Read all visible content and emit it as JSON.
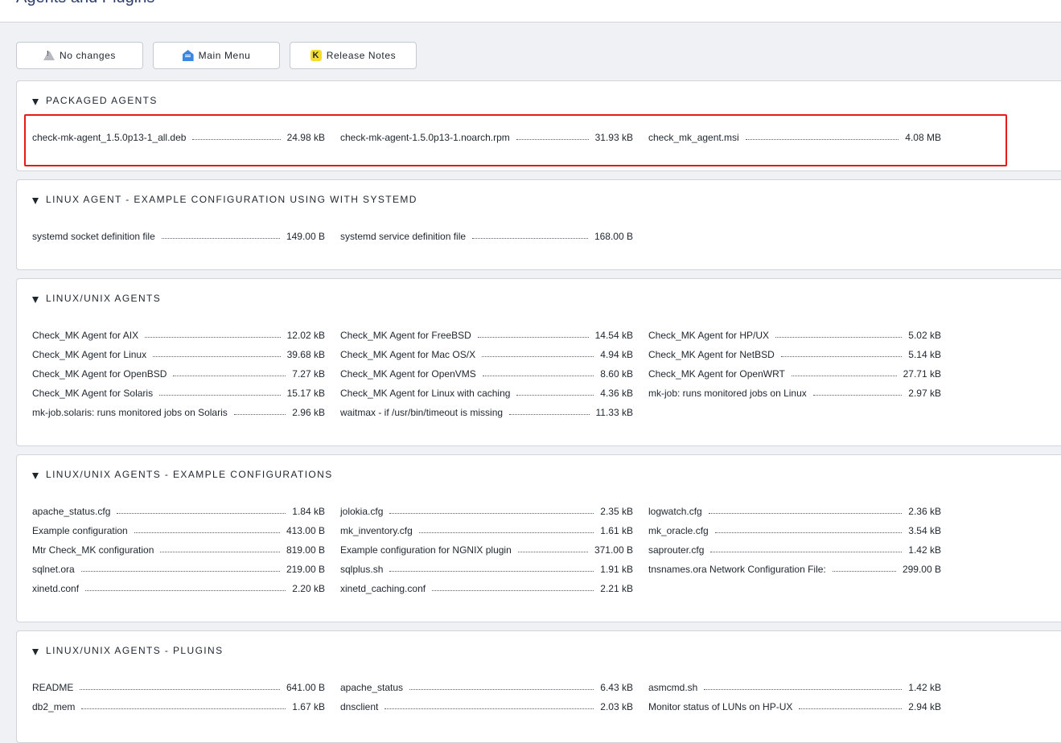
{
  "page": {
    "title": "Agents and Plugins"
  },
  "toolbar": {
    "no_changes_label": "No changes",
    "main_menu_label": "Main Menu",
    "release_notes_label": "Release Notes",
    "release_notes_icon_letter": "K"
  },
  "colors": {
    "highlight_border": "#e41b1b",
    "home_icon": "#3a86e0",
    "release_notes_icon": "#f5dc2e",
    "title_text": "#2d3e6d"
  },
  "sections": [
    {
      "title": "PACKAGED AGENTS",
      "highlighted": true,
      "items": [
        {
          "name": "check-mk-agent_1.5.0p13-1_all.deb",
          "size": "24.98 kB"
        },
        {
          "name": "check-mk-agent-1.5.0p13-1.noarch.rpm",
          "size": "31.93 kB"
        },
        {
          "name": "check_mk_agent.msi",
          "size": "4.08 MB"
        }
      ]
    },
    {
      "title": "LINUX AGENT - EXAMPLE CONFIGURATION USING WITH SYSTEMD",
      "items": [
        {
          "name": "systemd socket definition file",
          "size": "149.00 B"
        },
        {
          "name": "systemd service definition file",
          "size": "168.00 B"
        }
      ]
    },
    {
      "title": "LINUX/UNIX AGENTS",
      "items": [
        {
          "name": "Check_MK Agent for AIX",
          "size": "12.02 kB"
        },
        {
          "name": "Check_MK Agent for FreeBSD",
          "size": "14.54 kB"
        },
        {
          "name": "Check_MK Agent for HP/UX",
          "size": "5.02 kB"
        },
        {
          "name": "Check_MK Agent for Linux",
          "size": "39.68 kB"
        },
        {
          "name": "Check_MK Agent for Mac OS/X",
          "size": "4.94 kB"
        },
        {
          "name": "Check_MK Agent for NetBSD",
          "size": "5.14 kB"
        },
        {
          "name": "Check_MK Agent for OpenBSD",
          "size": "7.27 kB"
        },
        {
          "name": "Check_MK Agent for OpenVMS",
          "size": "8.60 kB"
        },
        {
          "name": "Check_MK Agent for OpenWRT",
          "size": "27.71 kB"
        },
        {
          "name": "Check_MK Agent for Solaris",
          "size": "15.17 kB"
        },
        {
          "name": "Check_MK Agent for Linux with caching",
          "size": "4.36 kB"
        },
        {
          "name": "mk-job: runs monitored jobs on Linux",
          "size": "2.97 kB"
        },
        {
          "name": "mk-job.solaris: runs monitored jobs on Solaris",
          "size": "2.96 kB"
        },
        {
          "name": "waitmax - if /usr/bin/timeout is missing",
          "size": "11.33 kB"
        }
      ]
    },
    {
      "title": "LINUX/UNIX AGENTS - EXAMPLE CONFIGURATIONS",
      "items": [
        {
          "name": "apache_status.cfg",
          "size": "1.84 kB"
        },
        {
          "name": "jolokia.cfg",
          "size": "2.35 kB"
        },
        {
          "name": "logwatch.cfg",
          "size": "2.36 kB"
        },
        {
          "name": "Example configuration",
          "size": "413.00 B"
        },
        {
          "name": "mk_inventory.cfg",
          "size": "1.61 kB"
        },
        {
          "name": "mk_oracle.cfg",
          "size": "3.54 kB"
        },
        {
          "name": "Mtr Check_MK configuration",
          "size": "819.00 B"
        },
        {
          "name": "Example configuration for NGNIX plugin",
          "size": "371.00 B"
        },
        {
          "name": "saprouter.cfg",
          "size": "1.42 kB"
        },
        {
          "name": "sqlnet.ora",
          "size": "219.00 B"
        },
        {
          "name": "sqlplus.sh",
          "size": "1.91 kB"
        },
        {
          "name": "tnsnames.ora Network Configuration File:",
          "size": "299.00 B"
        },
        {
          "name": "xinetd.conf",
          "size": "2.20 kB"
        },
        {
          "name": "xinetd_caching.conf",
          "size": "2.21 kB"
        }
      ]
    },
    {
      "title": "LINUX/UNIX AGENTS - PLUGINS",
      "items": [
        {
          "name": "README",
          "size": "641.00 B"
        },
        {
          "name": "apache_status",
          "size": "6.43 kB"
        },
        {
          "name": "asmcmd.sh",
          "size": "1.42 kB"
        },
        {
          "name": "db2_mem",
          "size": "1.67 kB"
        },
        {
          "name": "dnsclient",
          "size": "2.03 kB"
        },
        {
          "name": "Monitor status of LUNs on HP-UX",
          "size": "2.94 kB"
        }
      ]
    }
  ]
}
